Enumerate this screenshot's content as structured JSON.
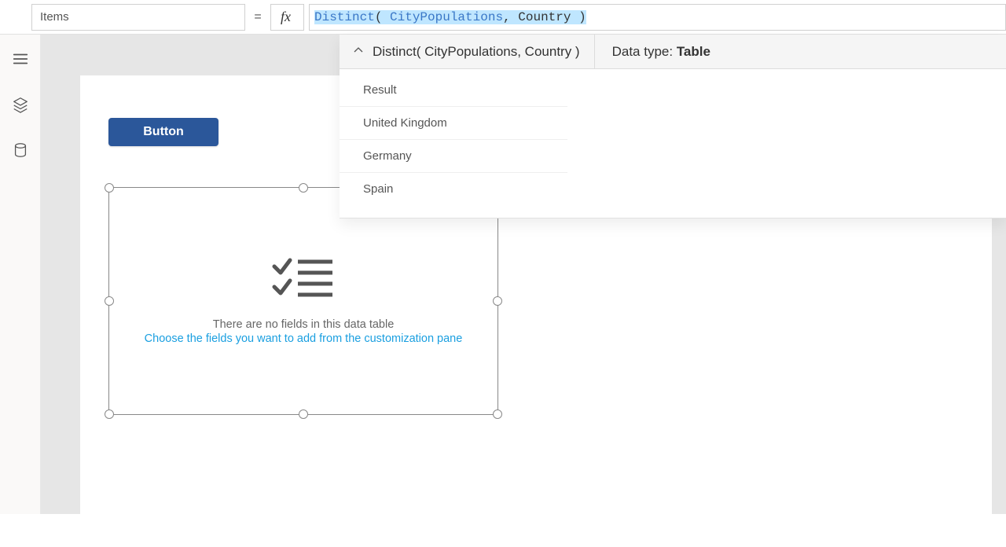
{
  "topbar": {
    "property": "Items",
    "formula": {
      "func": "Distinct",
      "open": "( ",
      "arg1": "CityPopulations",
      "comma": ",",
      "arg2": " Country ",
      "close": ")"
    }
  },
  "intellisense": {
    "signature": "Distinct( CityPopulations, Country )",
    "datatype_label": "Data type: ",
    "datatype_value": "Table",
    "columns": [
      "Result"
    ],
    "rows": [
      "United Kingdom",
      "Germany",
      "Spain"
    ]
  },
  "canvas": {
    "button_label": "Button",
    "dt_line1": "There are no fields in this data table",
    "dt_line2": "Choose the fields you want to add from the customization pane"
  },
  "icons": {
    "hamburger": "hamburger-icon",
    "layers": "layers-icon",
    "data": "data-icon",
    "chevron_down": "chevron-down-icon",
    "chevron_up": "chevron-up-icon",
    "fx": "fx"
  }
}
